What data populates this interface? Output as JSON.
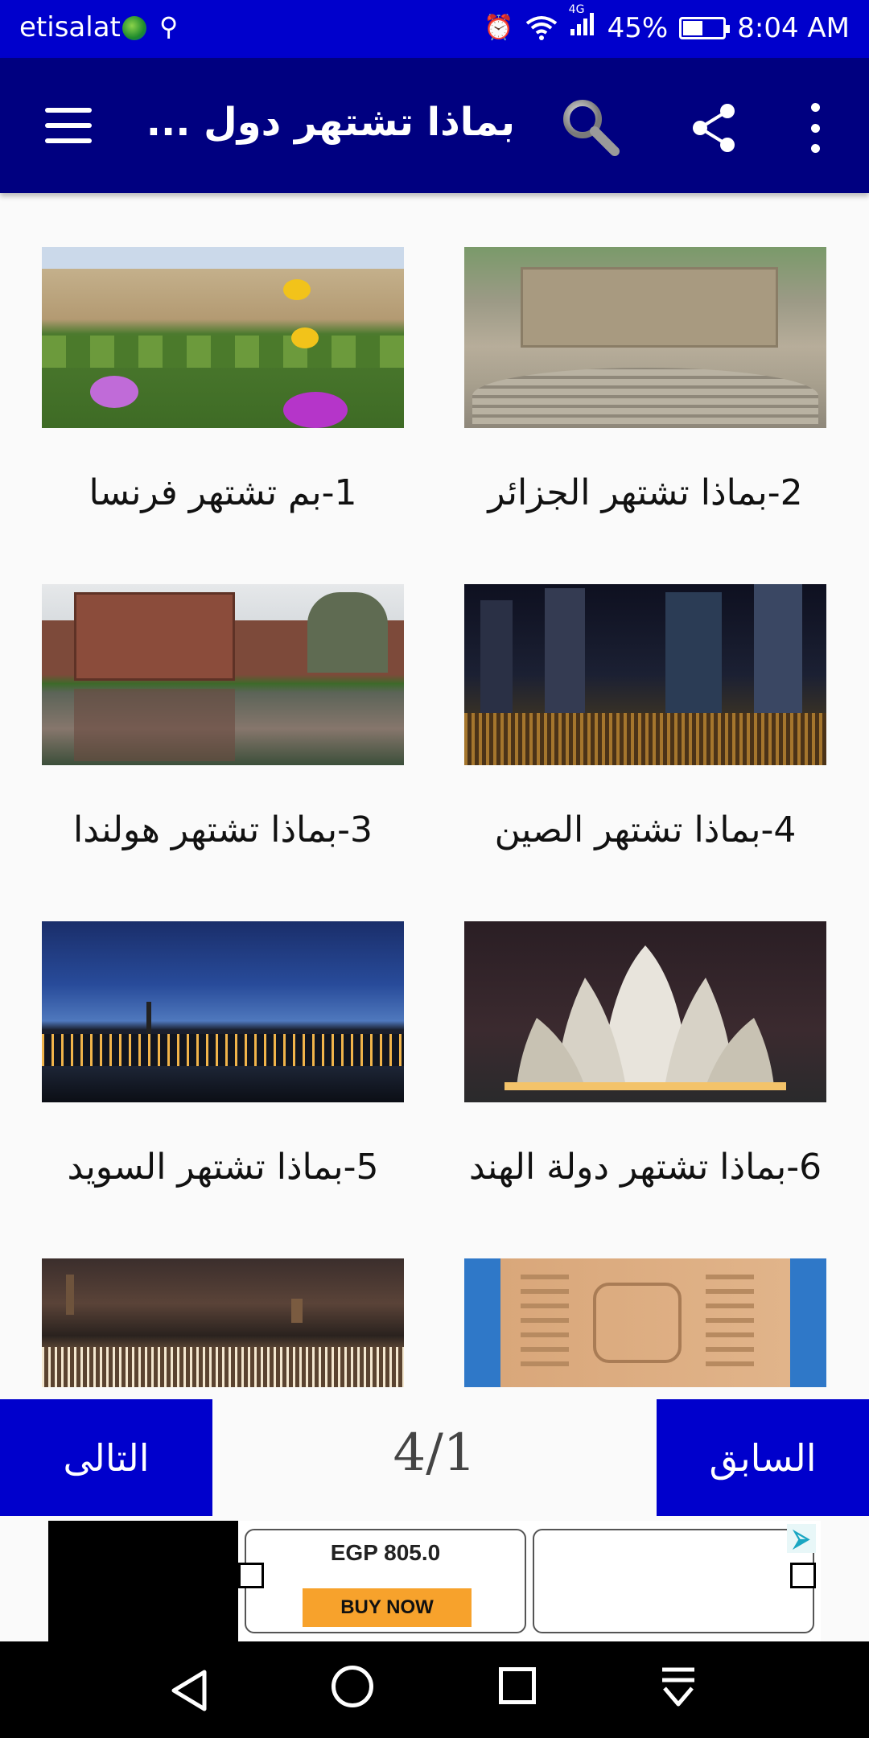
{
  "status_bar": {
    "carrier": "etisalat",
    "signal_type": "4G",
    "battery": "45%",
    "time": "8:04 AM",
    "icons": [
      "globe-icon",
      "usb-icon",
      "alarm-icon",
      "wifi-icon",
      "signal-icon",
      "battery-charging-icon"
    ]
  },
  "app_bar": {
    "title": "بماذا تشتهر دول ...",
    "icons": [
      "menu-icon",
      "search-icon",
      "share-icon",
      "more-vert-icon"
    ]
  },
  "items": [
    {
      "caption": "2-بماذا تشتهر الجزائر",
      "image": "roman-amphitheater-ruins"
    },
    {
      "caption": "1-بم تشتهر فرنسا",
      "image": "palace-garden-flowers"
    },
    {
      "caption": "4-بماذا تشتهر الصين",
      "image": "city-skyline-night-crowd"
    },
    {
      "caption": "3-بماذا تشتهر هولندا",
      "image": "brick-castle-reflection"
    },
    {
      "caption": "6-بماذا تشتهر دولة الهند",
      "image": "lotus-temple"
    },
    {
      "caption": "5-بماذا تشتهر السويد",
      "image": "city-dusk-skyline"
    },
    {
      "caption": "",
      "image": "egyptian-obelisk"
    },
    {
      "caption": "",
      "image": "marketplace-night"
    }
  ],
  "pagination": {
    "next_label": "التالى",
    "prev_label": "السابق",
    "page_indicator": "4/1"
  },
  "ad": {
    "price": "EGP 805.0",
    "button": "BUY NOW"
  },
  "colors": {
    "status_bar": "#0000cc",
    "app_bar": "#000080",
    "buttons": "#0000cc",
    "ad_button": "#f7a22c"
  }
}
